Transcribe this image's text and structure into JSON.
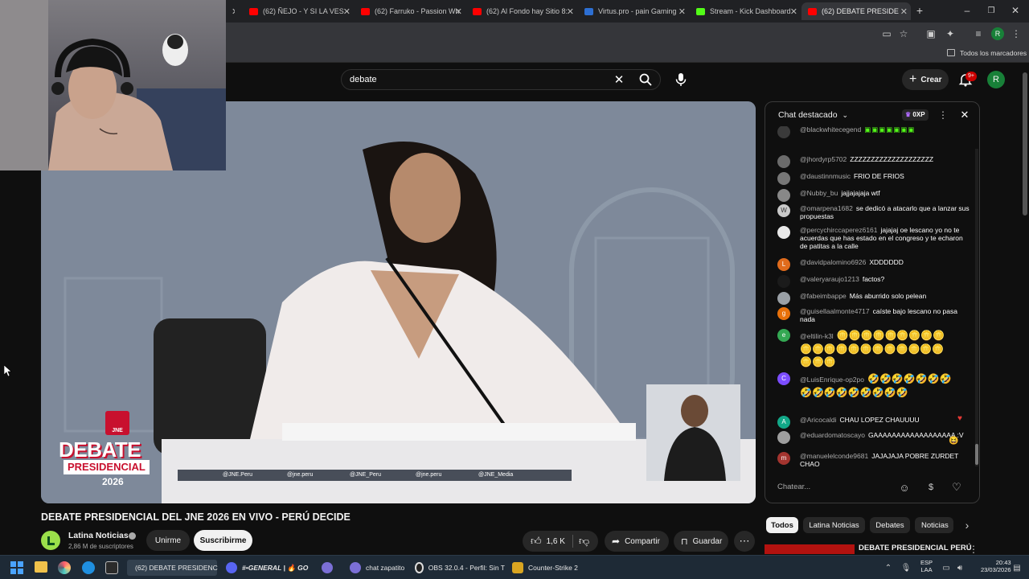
{
  "browser": {
    "tabs": [
      {
        "title": "(62) ÑEJO - Y SI LA VES -",
        "color": "#ff0000"
      },
      {
        "title": "(62) Farruko - Passion Wh",
        "color": "#ff0000"
      },
      {
        "title": "(62) Al Fondo hay Sitio 8:",
        "color": "#ff0000"
      },
      {
        "title": "Virtus.pro - pain Gaming",
        "color": "#2d6fd3"
      },
      {
        "title": "Stream - Kick Dashboard",
        "color": "#53fc18"
      },
      {
        "title": "(62) DEBATE PRESIDE",
        "color": "#ff0000"
      }
    ],
    "bookmarks_label": "Todos los marcadores",
    "profile_initial": "R"
  },
  "header": {
    "search_value": "debate",
    "create_label": "Crear",
    "notif_badge": "9+",
    "avatar": "R"
  },
  "video": {
    "logo_text": "JNE",
    "debate_word": "DEBATE",
    "presidencial_word": "PRESIDENCIAL",
    "year": "2026",
    "socials": [
      "@JNE.Peru",
      "@jne.peru",
      "@JNE_Peru",
      "@jne.peru",
      "@JNE_Media"
    ],
    "title": "DEBATE PRESIDENCIAL DEL JNE 2026 EN VIVO - PERÚ DECIDE",
    "channel": "Latina Noticias",
    "subscribers": "2,86 M de suscriptores",
    "join_label": "Unirme",
    "subscribe_label": "Suscribirme",
    "likes": "1,6 K",
    "share_label": "Compartir",
    "save_label": "Guardar"
  },
  "chat": {
    "title": "Chat destacado",
    "points": "0XP",
    "input_placeholder": "Chatear...",
    "messages": [
      {
        "author": "@blackwhitecegend",
        "text": "",
        "color": "#3a3a3a",
        "initial": ""
      },
      {
        "author": "@jhordyrp5702",
        "text": "ZZZZZZZZZZZZZZZZZZZZ",
        "color": "#6b6b6b",
        "initial": ""
      },
      {
        "author": "@daustinnmusic",
        "text": "FRIO DE FRIOS",
        "color": "#777",
        "initial": ""
      },
      {
        "author": "@Nubby_bu",
        "text": "jajjajajaja wtf",
        "color": "#888",
        "initial": ""
      },
      {
        "author": "@omarpena1682",
        "text": "se dedicó a atacarlo que a lanzar sus propuestas",
        "color": "#c9c9c9",
        "initial": "W"
      },
      {
        "author": "@percychirccaperez6161",
        "text": "jajajaj oe lescano yo no te acuerdas que has estado en el congreso y te echaron de patitas a la calle",
        "color": "#e8e8e8",
        "initial": ""
      },
      {
        "author": "@davidpalomino6926",
        "text": "XDDDDDD",
        "color": "#e06b1c",
        "initial": "L"
      },
      {
        "author": "@valeryaraujo1213",
        "text": "factos?",
        "color": "#1b1b1b",
        "initial": ""
      },
      {
        "author": "@fabeimbappe",
        "text": "Más aburrido solo pelean",
        "color": "#9aa0a6",
        "initial": ""
      },
      {
        "author": "@guisellaalmonte4717",
        "text": "caíste bajo lescano no pasa nada",
        "color": "#e8710a",
        "initial": "g"
      },
      {
        "author": "@eltilin-k3l",
        "text": "🪙🪙🪙🪙🪙🪙🪙🪙🪙🪙🪙🪙🪙🪙🪙🪙🪙🪙🪙🪙🪙🪙🪙🪙",
        "color": "#34a853",
        "initial": "e"
      },
      {
        "author": "@LuisEnrique-op2po",
        "text": "🤣🤣🤣🤣🤣🤣🤣🤣🤣🤣🤣🤣🤣🤣🤣🤣",
        "color": "#7c4dff",
        "initial": "C"
      },
      {
        "author": "@Aricocaldi",
        "text": "CHAU LOPEZ CHAUUUU",
        "color": "#12a888",
        "initial": "A"
      },
      {
        "author": "@eduardomatoscayo",
        "text": "GAAAAAAAAAAAAAAAAAA :V",
        "color": "#9e9e9e",
        "initial": ""
      },
      {
        "author": "@manuelelconde9681",
        "text": "JAJAJAJA POBRE ZURDET CHAO",
        "color": "#a3342f",
        "initial": "m"
      }
    ]
  },
  "chips": [
    "Todos",
    "Latina Noticias",
    "Debates",
    "Noticias"
  ],
  "related": {
    "title": "DEBATE PRESIDENCIAL PERÚ"
  },
  "taskbar": {
    "items": [
      "(62) DEBATE PRESIDENC",
      "#•GENERAL | 🔥 GO",
      "chat zapatito",
      "OBS 32.0.4 - Perfil: Sin T",
      "Counter-Strike 2"
    ],
    "lang_top": "ESP",
    "lang_bottom": "LAA",
    "time": "20:43",
    "date": "23/03/2026"
  }
}
